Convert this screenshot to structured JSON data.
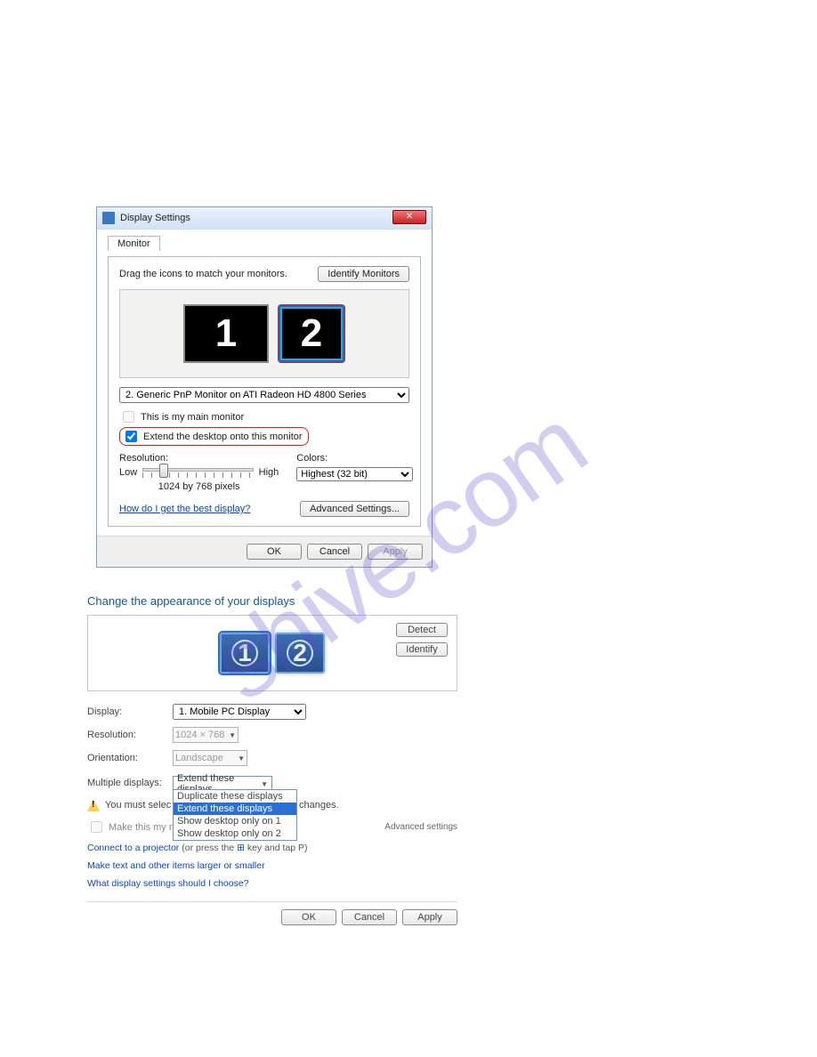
{
  "watermark": "shive.com",
  "dlg1": {
    "title": "Display Settings",
    "close_glyph": "✕",
    "tab_label": "Monitor",
    "drag_hint": "Drag the icons to match your monitors.",
    "identify_btn": "Identify Monitors",
    "mon1_num": "1",
    "mon2_num": "2",
    "monitor_select": "2. Generic PnP Monitor on ATI Radeon HD 4800 Series",
    "main_monitor_label": "This is my main monitor",
    "extend_label": "Extend the desktop onto this monitor",
    "resolution_label": "Resolution:",
    "low_label": "Low",
    "high_label": "High",
    "res_value": "1024 by 768 pixels",
    "colors_label": "Colors:",
    "colors_value": "Highest (32 bit)",
    "help_link": "How do I get the best display?",
    "adv_btn": "Advanced Settings...",
    "ok": "OK",
    "cancel": "Cancel",
    "apply": "Apply"
  },
  "pnl2": {
    "heading": "Change the appearance of your displays",
    "detect_btn": "Detect",
    "identify_btn": "Identify",
    "mon1_num": "1",
    "mon2_num": "2",
    "display_label": "Display:",
    "display_value": "1. Mobile PC Display",
    "resolution_label": "Resolution:",
    "resolution_value": "1024 × 768",
    "orientation_label": "Orientation:",
    "orientation_value": "Landscape",
    "multi_label": "Multiple displays:",
    "multi_value": "Extend these displays",
    "multi_options": [
      "Duplicate these displays",
      "Extend these displays",
      "Show desktop only on 1",
      "Show desktop only on 2"
    ],
    "warn_prefix": "You must selec",
    "warn_suffix": "anal changes.",
    "make_main_label": "Make this my ma",
    "adv_settings": "Advanced settings",
    "projector_link": "Connect to a projector",
    "projector_tail": " (or press the ",
    "projector_tail2": " key and tap P)",
    "text_size_link": "Make text and other items larger or smaller",
    "which_settings_link": "What display settings should I choose?",
    "ok": "OK",
    "cancel": "Cancel",
    "apply": "Apply"
  }
}
